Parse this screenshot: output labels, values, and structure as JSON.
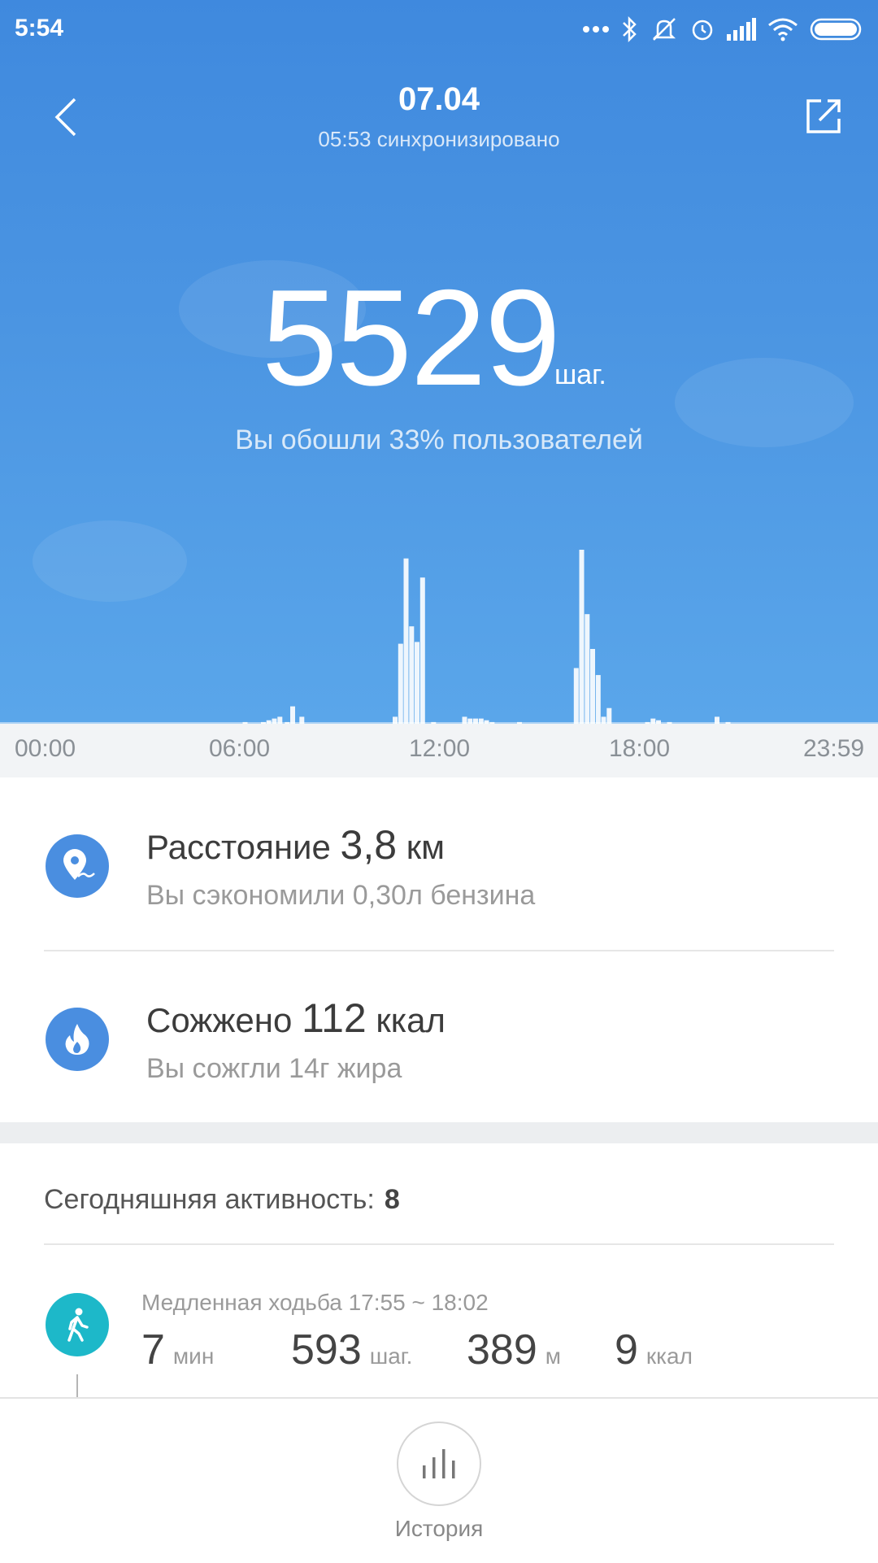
{
  "status_bar": {
    "time": "5:54",
    "icons": [
      "more-dots-icon",
      "bluetooth-icon",
      "mute-icon",
      "alarm-icon",
      "signal-icon",
      "wifi-icon",
      "battery-icon"
    ]
  },
  "header": {
    "date": "07.04",
    "sync_status": "05:53 синхронизировано",
    "back_icon": "back-chevron-icon",
    "share_icon": "share-icon"
  },
  "summary": {
    "steps": "5529",
    "steps_unit": "шаг.",
    "rank_text": "Вы обошли 33% пользователей"
  },
  "chart_data": {
    "type": "bar",
    "x_unit": "hour of day",
    "xlim": [
      0,
      24
    ],
    "x_ticks": [
      "00:00",
      "06:00",
      "12:00",
      "18:00",
      "23:59"
    ],
    "bars": [
      {
        "x": 6.7,
        "y": 1
      },
      {
        "x": 7.2,
        "y": 1
      },
      {
        "x": 7.35,
        "y": 2
      },
      {
        "x": 7.5,
        "y": 3
      },
      {
        "x": 7.65,
        "y": 4
      },
      {
        "x": 7.85,
        "y": 1
      },
      {
        "x": 8.0,
        "y": 10
      },
      {
        "x": 8.25,
        "y": 4
      },
      {
        "x": 10.8,
        "y": 4
      },
      {
        "x": 10.95,
        "y": 46
      },
      {
        "x": 11.1,
        "y": 95
      },
      {
        "x": 11.25,
        "y": 56
      },
      {
        "x": 11.4,
        "y": 47
      },
      {
        "x": 11.55,
        "y": 84
      },
      {
        "x": 11.85,
        "y": 1
      },
      {
        "x": 12.7,
        "y": 4
      },
      {
        "x": 12.85,
        "y": 3
      },
      {
        "x": 13.0,
        "y": 3
      },
      {
        "x": 13.15,
        "y": 3
      },
      {
        "x": 13.3,
        "y": 2
      },
      {
        "x": 13.45,
        "y": 1
      },
      {
        "x": 14.2,
        "y": 1
      },
      {
        "x": 15.75,
        "y": 32
      },
      {
        "x": 15.9,
        "y": 100
      },
      {
        "x": 16.05,
        "y": 63
      },
      {
        "x": 16.2,
        "y": 43
      },
      {
        "x": 16.35,
        "y": 28
      },
      {
        "x": 16.5,
        "y": 4
      },
      {
        "x": 16.65,
        "y": 9
      },
      {
        "x": 17.7,
        "y": 1
      },
      {
        "x": 17.85,
        "y": 3
      },
      {
        "x": 18.0,
        "y": 2
      },
      {
        "x": 18.3,
        "y": 1
      },
      {
        "x": 19.6,
        "y": 4
      },
      {
        "x": 19.9,
        "y": 1
      }
    ],
    "ylim": [
      0,
      100
    ]
  },
  "stats": {
    "distance": {
      "label": "Расстояние",
      "value": "3,8",
      "unit": "км",
      "sub": "Вы сэкономили 0,30л бензина",
      "icon": "location-pin-icon"
    },
    "calories": {
      "label": "Сожжено",
      "value": "112",
      "unit": "ккал",
      "sub": "Вы сожгли 14г жира",
      "icon": "flame-icon"
    }
  },
  "activity": {
    "header_label": "Сегодняшняя активность:",
    "count": "8",
    "item": {
      "title": "Медленная ходьба 17:55 ~ 18:02",
      "icon": "walking-person-icon",
      "duration": {
        "value": "7",
        "unit": "мин"
      },
      "steps": {
        "value": "593",
        "unit": "шаг."
      },
      "distance": {
        "value": "389",
        "unit": "м"
      },
      "calories": {
        "value": "9",
        "unit": "ккал"
      }
    }
  },
  "bottom": {
    "history_label": "История",
    "history_icon": "bar-chart-icon"
  },
  "colors": {
    "hero_top": "#3f89de",
    "hero_bottom": "#5aa6ea",
    "accent_blue": "#4a8ee0",
    "walk_teal": "#1db8c9"
  }
}
